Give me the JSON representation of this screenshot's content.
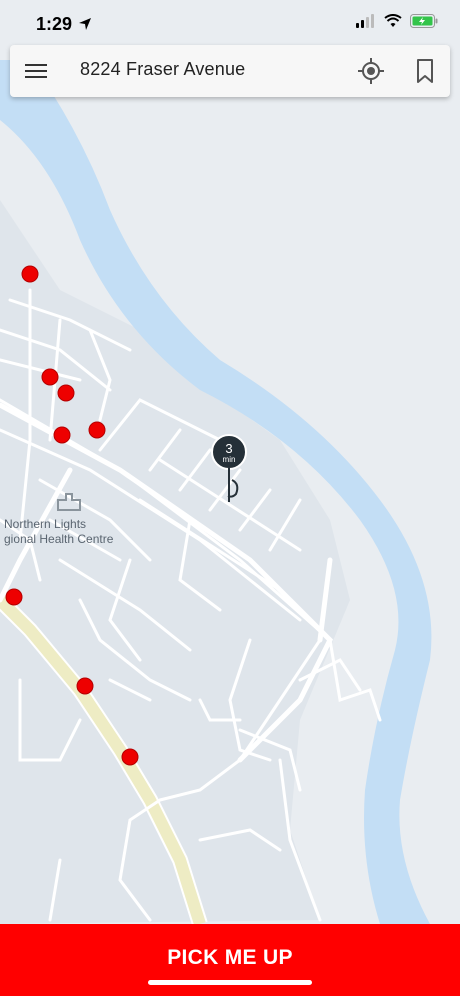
{
  "status_bar": {
    "time": "1:29"
  },
  "search": {
    "address": "8224 Fraser Avenue"
  },
  "eta": {
    "minutes": "3",
    "unit": "min"
  },
  "map": {
    "place_label_line1": "Northern Lights",
    "place_label_line2": "gional Health Centre"
  },
  "action": {
    "label": "PICK ME UP"
  },
  "colors": {
    "accent": "#ff0000",
    "river": "#c3def5",
    "land": "#e9edf1",
    "stop": "#ee0000",
    "pin": "#253038"
  },
  "icons": [
    "location-arrow-icon",
    "signal-icon",
    "wifi-icon",
    "battery-charging-icon",
    "hamburger-menu-icon",
    "locate-icon",
    "bookmark-icon"
  ]
}
